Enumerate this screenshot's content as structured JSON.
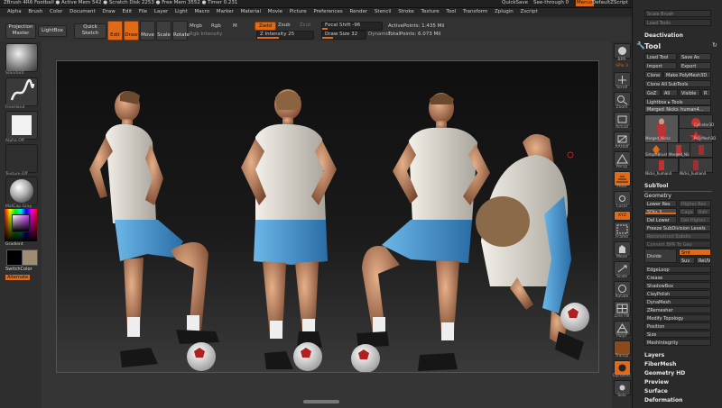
{
  "title_bar": {
    "text": "ZBrush 4R6    Football    ● Active Mem 542 ● Scratch Disk 2253 ● Free Mem 3552 ● Timer 0.231",
    "quicksave": "QuickSave",
    "seethrough": "See-through   0",
    "menus": "Menus",
    "default_script": "DefaultZScript"
  },
  "menu": [
    "Alpha",
    "Brush",
    "Color",
    "Document",
    "Draw",
    "Edit",
    "File",
    "Layer",
    "Light",
    "Macro",
    "Marker",
    "Material",
    "Movie",
    "Picture",
    "Preferences",
    "Render",
    "Stencil",
    "Stroke",
    "Texture",
    "Tool",
    "Transform",
    "Zplugin",
    "Zscript"
  ],
  "shelf": {
    "projection_master": "Projection Master",
    "lightbox": "LightBox",
    "quick_sketch": "Quick Sketch",
    "edit": "Edit",
    "draw": "Draw",
    "move": "Move",
    "scale": "Scale",
    "rotate": "Rotate",
    "mrgb": "Mrgb",
    "rgb": "Rgb",
    "m": "M",
    "rgb_intensity": "Rgb Intensity",
    "zadd": "Zadd",
    "zsub": "Zsub",
    "zcut": "Zcut",
    "z_intensity": "Z Intensity 25",
    "focal_shift": "Focal Shift -96",
    "draw_size": "Draw Size 32",
    "dynamic": "Dynamic",
    "active_points": "ActivePoints: 1.435 Mil",
    "total_points": "TotalPoints: 6.073 Mil"
  },
  "left_shelf": {
    "brush_label": "Standard",
    "stroke_label": "FreeHand",
    "alpha_label": "Alpha Off",
    "texture_label": "Texture Off",
    "material_label": "MatCap Gray",
    "gradient": "Gradient",
    "switch_color": "SwitchColor",
    "alternate": "Alternate"
  },
  "right_shelf": [
    "BPR",
    "SPix 3",
    "Scroll",
    "Zoom",
    "Actual",
    "AAHalf",
    "Persp",
    "Floor",
    "Local",
    "XYZ",
    "Frame",
    "Move",
    "Scale",
    "Rotate",
    "Line Fill",
    "PolyF",
    "Transp",
    "Dynamic",
    "Solo"
  ],
  "tray": {
    "top_items": [
      "Deactivation",
      "Load Tools",
      "Save Tools",
      "Scale Brush",
      "Hide Brush"
    ],
    "tool_title": "Tool",
    "load_tool": "Load Tool",
    "save_as": "Save As",
    "import": "Import",
    "export": "Export",
    "clone": "Clone",
    "make_polymesh": "Make PolyMesh3D",
    "clone_all": "Clone All SubTools",
    "goz": "GoZ",
    "all": "All",
    "visible": "Visible",
    "r": "R",
    "lightbox_tools": "Lightbox ▸ Tools",
    "current_tool": "Merged_Nicks_human4...",
    "thumbs": [
      "Merged_Nicks",
      "Cylinder3D",
      "PolyMesh3D",
      "SimpleBrush",
      "Merged_Nicks_h",
      "Nicks_human4",
      "Nicks_human4"
    ],
    "subtool": "SubTool",
    "geometry": "Geometry",
    "lower_res": "Lower Res",
    "higher_res": "Higher Res",
    "sdiv": "SDiv 3",
    "cage": "Cage",
    "rstr": "Rstr",
    "del_lower": "Del Lower",
    "del_higher": "Del Higher",
    "freeze": "Freeze SubDivision Levels",
    "reconstruct": "Reconstruct Subdiv",
    "convert_bpr": "Convert BPR To Geo",
    "divide": "Divide",
    "smt": "Smt",
    "suv": "Suv",
    "reuv": "ReUV",
    "sections": [
      "EdgeLoop",
      "Crease",
      "ShadowBox",
      "ClayPolish",
      "DynaMesh",
      "ZRemesher",
      "Modify Topology",
      "Position",
      "Size",
      "MeshIntegrity"
    ],
    "lower_sections": [
      "Layers",
      "FiberMesh",
      "Geometry HD",
      "Preview",
      "Surface",
      "Deformation"
    ]
  },
  "colors": {
    "accent": "#e06a18",
    "background": "#2b2b2b",
    "canvas_top": "#0f0f0f",
    "canvas_bottom": "#3a3a3a"
  }
}
